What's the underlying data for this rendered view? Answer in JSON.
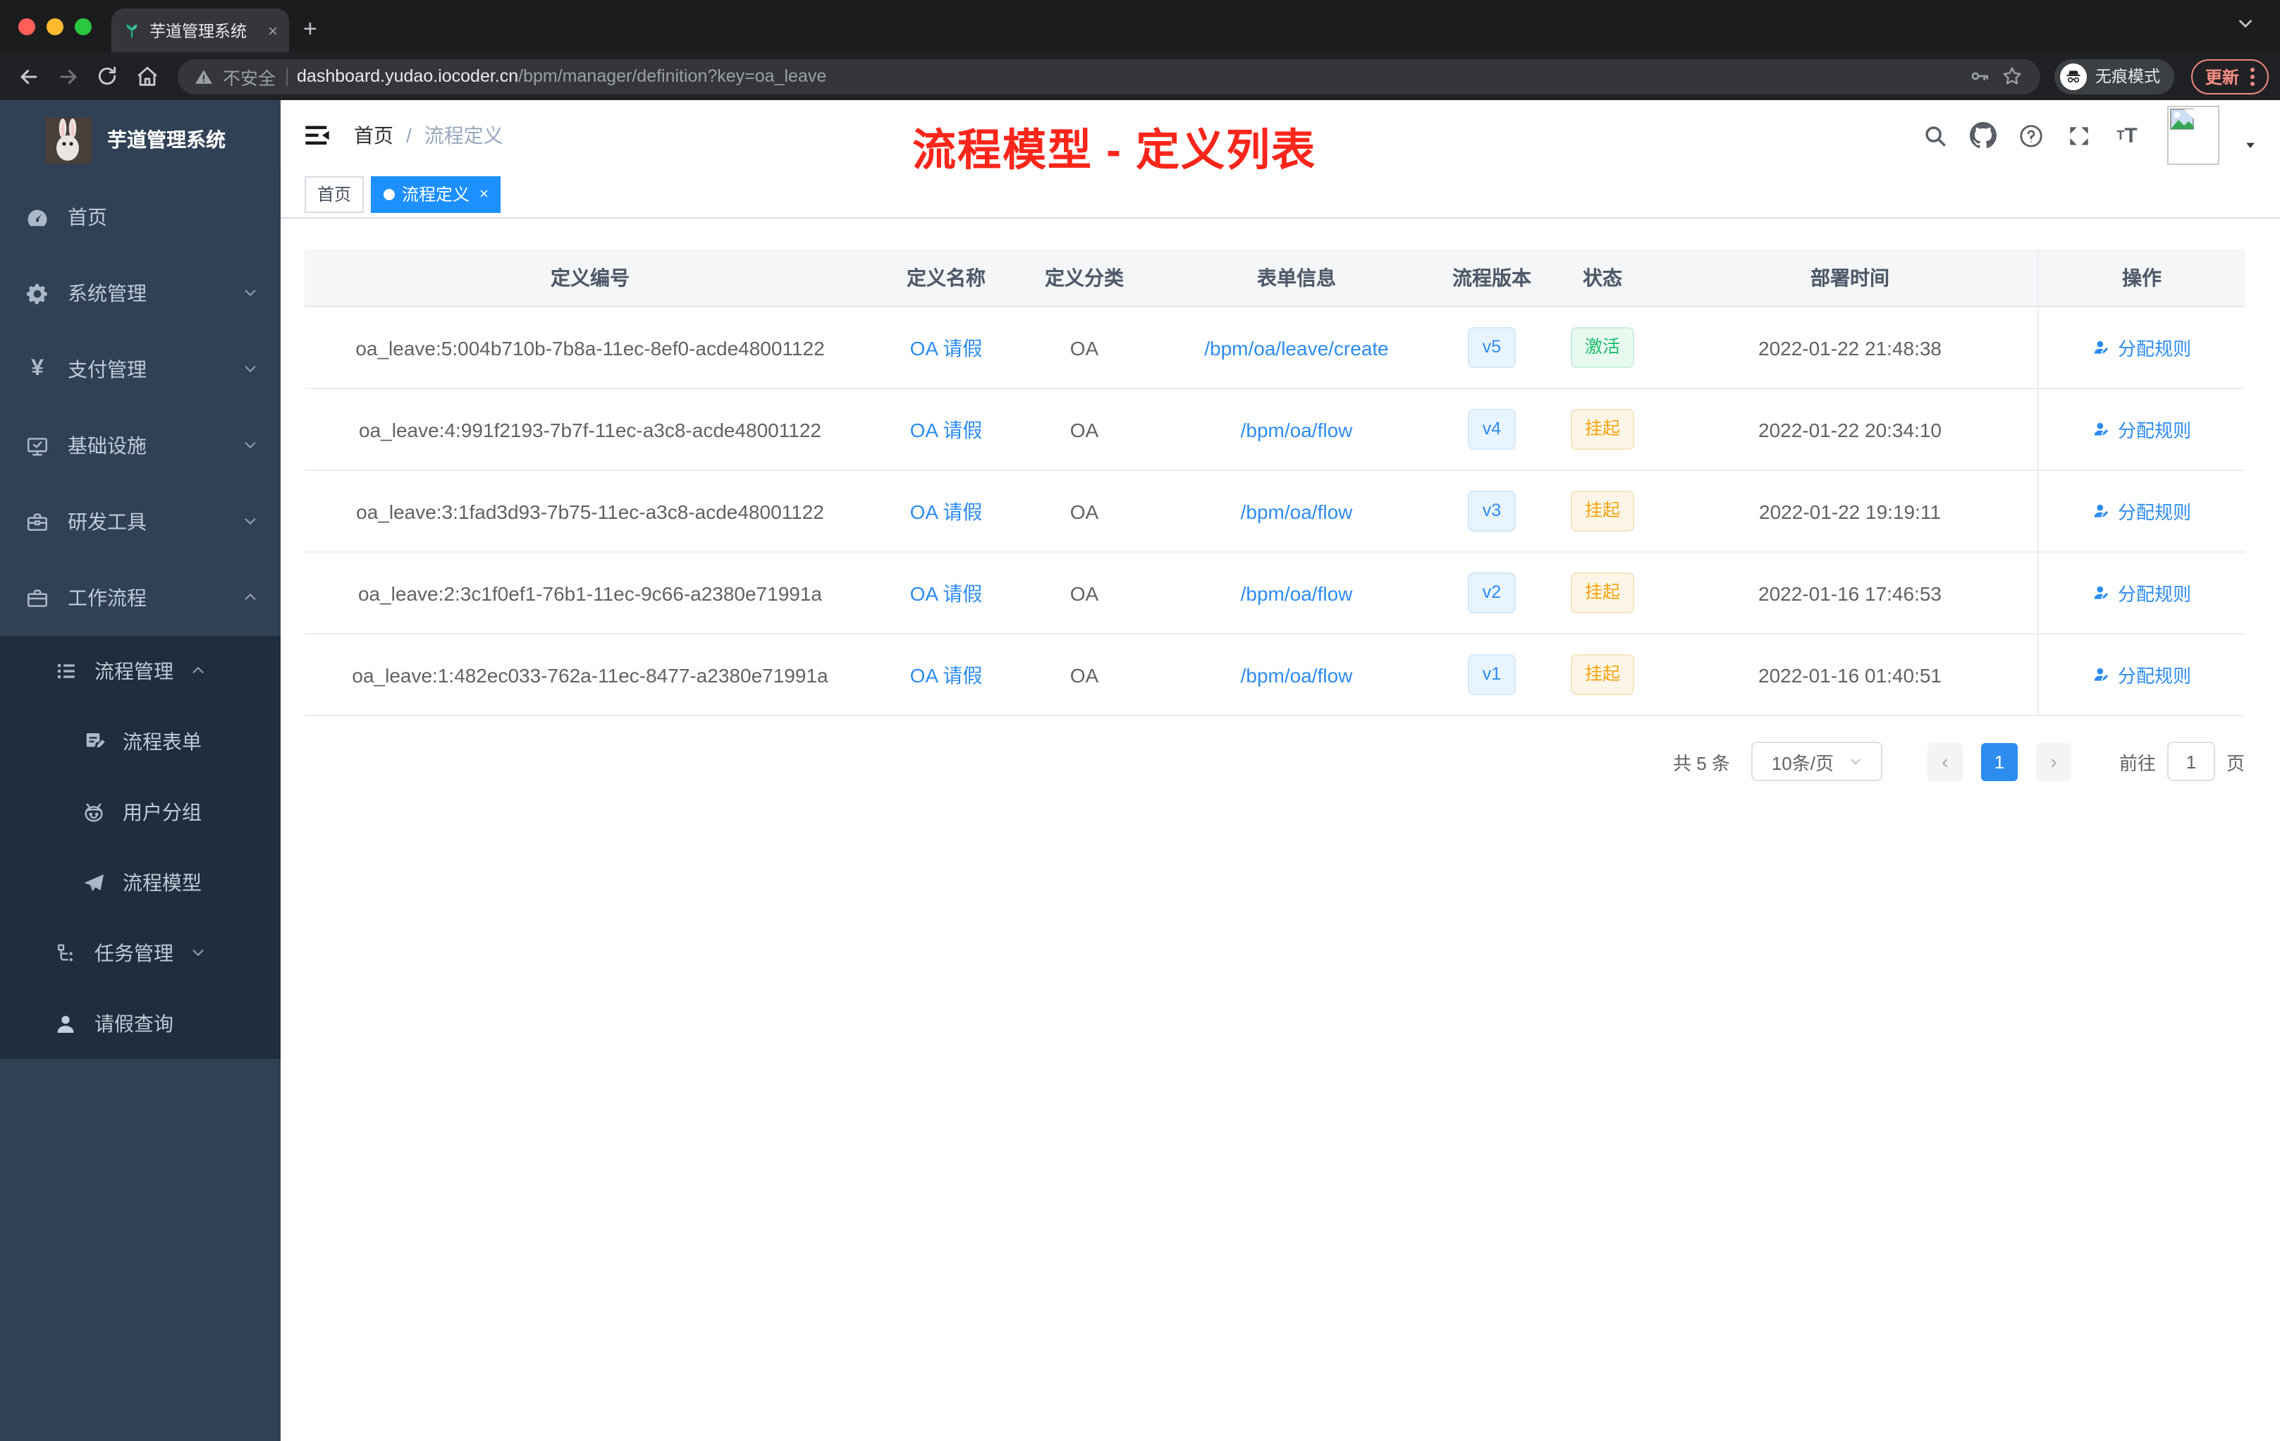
{
  "browser": {
    "tab": {
      "title": "芋道管理系统",
      "close": "×",
      "new_tab": "+"
    },
    "toolbar": {
      "security_label": "不安全",
      "url_host": "dashboard.yudao.iocoder.cn",
      "url_path": "/bpm/manager/definition?key=oa_leave",
      "incognito_label": "无痕模式",
      "update_label": "更新"
    }
  },
  "sidebar": {
    "app_title": "芋道管理系统",
    "items": [
      {
        "label": "首页",
        "icon": "dashboard-icon"
      },
      {
        "label": "系统管理",
        "icon": "gear-icon",
        "chevron": "down"
      },
      {
        "label": "支付管理",
        "icon": "yen-icon",
        "chevron": "down"
      },
      {
        "label": "基础设施",
        "icon": "monitor-icon",
        "chevron": "down"
      },
      {
        "label": "研发工具",
        "icon": "toolbox-icon",
        "chevron": "down"
      },
      {
        "label": "工作流程",
        "icon": "briefcase-icon",
        "chevron": "up"
      },
      {
        "label": "流程管理",
        "icon": "list-icon",
        "chevron": "up"
      },
      {
        "label": "流程表单",
        "icon": "form-icon"
      },
      {
        "label": "用户分组",
        "icon": "robot-icon"
      },
      {
        "label": "流程模型",
        "icon": "plane-icon"
      },
      {
        "label": "任务管理",
        "icon": "tree-icon",
        "chevron": "down"
      },
      {
        "label": "请假查询",
        "icon": "user-icon"
      }
    ]
  },
  "header": {
    "breadcrumb": {
      "home": "首页",
      "separator": "/",
      "current": "流程定义"
    },
    "annotation": "流程模型 - 定义列表"
  },
  "tags": {
    "home": "首页",
    "active": "流程定义",
    "close": "×"
  },
  "table": {
    "columns": [
      "定义编号",
      "定义名称",
      "定义分类",
      "表单信息",
      "流程版本",
      "状态",
      "部署时间",
      "操作"
    ],
    "action_label": "分配规则",
    "rows": [
      {
        "id": "oa_leave:5:004b710b-7b8a-11ec-8ef0-acde48001122",
        "name": "OA 请假",
        "category": "OA",
        "form": "/bpm/oa/leave/create",
        "version": "v5",
        "status": "激活",
        "time": "2022-01-22 21:48:38",
        "action": "分配规则"
      },
      {
        "id": "oa_leave:4:991f2193-7b7f-11ec-a3c8-acde48001122",
        "name": "OA 请假",
        "category": "OA",
        "form": "/bpm/oa/flow",
        "version": "v4",
        "status": "挂起",
        "time": "2022-01-22 20:34:10",
        "action": "分配规则"
      },
      {
        "id": "oa_leave:3:1fad3d93-7b75-11ec-a3c8-acde48001122",
        "name": "OA 请假",
        "category": "OA",
        "form": "/bpm/oa/flow",
        "version": "v3",
        "status": "挂起",
        "time": "2022-01-22 19:19:11",
        "action": "分配规则"
      },
      {
        "id": "oa_leave:2:3c1f0ef1-76b1-11ec-9c66-a2380e71991a",
        "name": "OA 请假",
        "category": "OA",
        "form": "/bpm/oa/flow",
        "version": "v2",
        "status": "挂起",
        "time": "2022-01-16 17:46:53",
        "action": "分配规则"
      },
      {
        "id": "oa_leave:1:482ec033-762a-11ec-8477-a2380e71991a",
        "name": "OA 请假",
        "category": "OA",
        "form": "/bpm/oa/flow",
        "version": "v1",
        "status": "挂起",
        "time": "2022-01-16 01:40:51",
        "action": "分配规则"
      }
    ]
  },
  "pagination": {
    "total": "共 5 条",
    "page_size": "10条/页",
    "prev": "‹",
    "current_page": "1",
    "next": "›",
    "goto_label": "前往",
    "goto_value": "1",
    "unit_label": "页"
  },
  "colors": {
    "accent_blue": "#2d8cf0",
    "active_green": "#19be6b",
    "suspend_orange": "#f7a30d",
    "annotation_red": "#fb261b",
    "sidebar_bg": "#304156",
    "submenu_bg": "#1f2d3d"
  }
}
